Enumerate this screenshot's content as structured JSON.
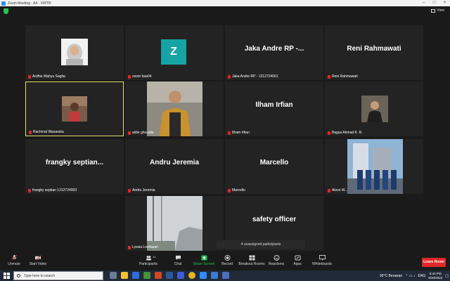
{
  "window": {
    "title": "Zoom Meeting - A4 - VIRTR"
  },
  "topbar": {
    "view_label": "View"
  },
  "tiles": [
    {
      "name_big": "",
      "label": "Ardhia Wahyu Sagita"
    },
    {
      "name_big": "",
      "avatar_letter": "Z",
      "label": "zoom baa04"
    },
    {
      "name_big": "Jaka Andre RP -...",
      "label": "Jaka Andre RP - 1212724001"
    },
    {
      "name_big": "Reni Rahmawati",
      "label": "Reni Rahmawati"
    },
    {
      "name_big": "",
      "label": "Rachmat Wasaraka"
    },
    {
      "name_big": "",
      "label": "aldie ghozalie"
    },
    {
      "name_big": "Ilham Irfian",
      "label": "Ilham Irfian"
    },
    {
      "name_big": "",
      "label": "Bagus Ahmad K. R."
    },
    {
      "name_big": "frangky  septian...",
      "label": "frangky septian 1212724003"
    },
    {
      "name_big": "Andru Jeremia",
      "label": "Andru Jeremia"
    },
    {
      "name_big": "Marcello",
      "label": "Marcello"
    },
    {
      "name_big": "",
      "label": "Alvon W..."
    },
    {
      "name_big": "",
      "label": "Lyssia Lovitasari"
    },
    {
      "name_big": "safety officer",
      "label": ""
    }
  ],
  "chip": {
    "text": "4 unassigned participants"
  },
  "toolbar": {
    "unmute": "Unmute",
    "start_video": "Start Video",
    "participants": "Participants",
    "participants_count": "14",
    "chat": "Chat",
    "share_screen": "Share Screen",
    "record": "Record",
    "breakout_rooms": "Breakout Rooms",
    "reactions": "Reactions",
    "apps": "Apps",
    "whiteboards": "Whiteboards",
    "leave_room": "Leave Room"
  },
  "taskbar": {
    "search_placeholder": "Type here to search",
    "weather": "30°C  Berawan",
    "time": "6:44 PM",
    "date": "9/30/2022",
    "lang": "ENG"
  },
  "colors": {
    "accent_green": "#23c552",
    "leave_red": "#e02828",
    "active_border": "#e3e36a",
    "zoom_blue": "#2d8cff"
  }
}
